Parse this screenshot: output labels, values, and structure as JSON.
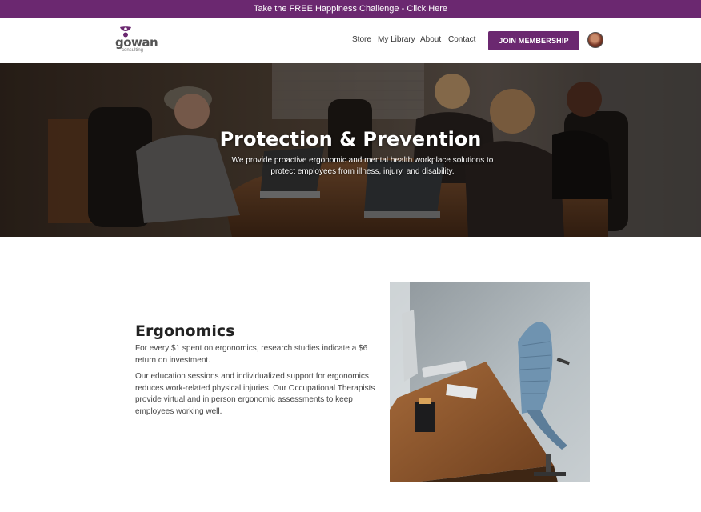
{
  "announcement": {
    "text": "Take the FREE Happiness Challenge - Click Here"
  },
  "brand": {
    "logo_word": "gowan",
    "logo_sub": "consulting"
  },
  "nav": {
    "items": [
      {
        "label": "Store"
      },
      {
        "label": "My Library"
      },
      {
        "label": "About"
      },
      {
        "label": "Contact"
      }
    ],
    "cta_label": "JOIN MEMBERSHIP"
  },
  "hero": {
    "title": "Protection & Prevention",
    "subtitle": "We provide proactive ergonomic and mental health workplace solutions to protect employees from illness, injury, and disability."
  },
  "ergonomics": {
    "title": "Ergonomics",
    "p1": "For every $1 spent on ergonomics, research studies indicate a $6 return on investment.",
    "p2": "Our education sessions and individualized support for ergonomics reduces work-related physical injuries.  Our Occupational Therapists provide virtual and in person ergonomic assessments to keep employees working well."
  },
  "colors": {
    "brand_purple": "#6b2870"
  }
}
